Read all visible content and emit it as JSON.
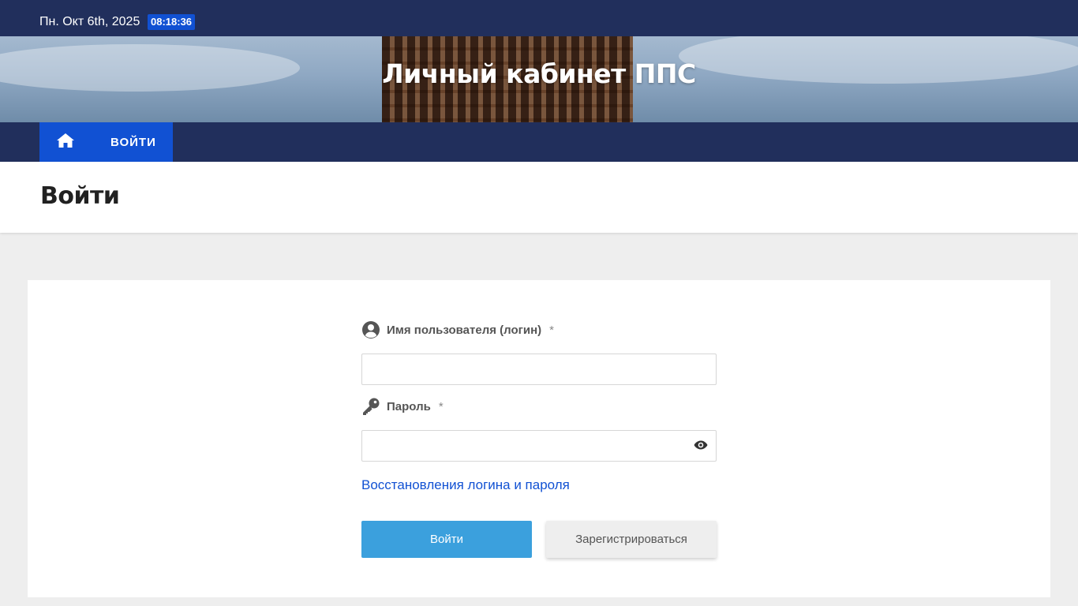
{
  "topbar": {
    "date": "Пн. Окт 6th, 2025",
    "time": "08:18:36"
  },
  "site": {
    "title": "Личный кабинет ППС"
  },
  "nav": {
    "home_icon": "home-icon",
    "login_label": "ВОЙТИ"
  },
  "page": {
    "heading": "Войти"
  },
  "form": {
    "username": {
      "icon": "user-circle-icon",
      "label": "Имя пользователя (логин)",
      "required_mark": "*",
      "value": "",
      "placeholder": ""
    },
    "password": {
      "icon": "key-icon",
      "label": "Пароль",
      "required_mark": "*",
      "value": "",
      "placeholder": "",
      "toggle_icon": "eye-icon"
    },
    "recover_link": "Восстановления логина и пароля",
    "submit_label": "Войти",
    "register_label": "Зарегистрироваться"
  },
  "colors": {
    "navy": "#212f5c",
    "accent_blue": "#1151d3",
    "button_blue": "#3ba0dd",
    "page_bg": "#eeeeee"
  }
}
